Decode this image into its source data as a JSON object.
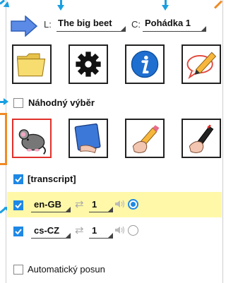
{
  "header": {
    "lesson_prefix": "L:",
    "lesson_value": "The big beet",
    "chapter_prefix": "C:",
    "chapter_value": "Pohádka 1"
  },
  "random_selection": {
    "label": "Náhodný výběr",
    "checked": false
  },
  "transcript": {
    "label": "[transcript]",
    "checked": true
  },
  "tracks": [
    {
      "language": "en-GB",
      "repeat_count": "1",
      "enabled": true,
      "selected": true,
      "highlighted": true
    },
    {
      "language": "cs-CZ",
      "repeat_count": "1",
      "enabled": true,
      "selected": false,
      "highlighted": false
    }
  ],
  "auto_scroll": {
    "label": "Automatický posun",
    "checked": false
  },
  "colors": {
    "accent": "#1e88e5",
    "annotation_blue": "#1a9fe0",
    "annotation_orange": "#f08a24",
    "highlight": "#fff8a8",
    "active_tile_border": "#e0302a"
  }
}
